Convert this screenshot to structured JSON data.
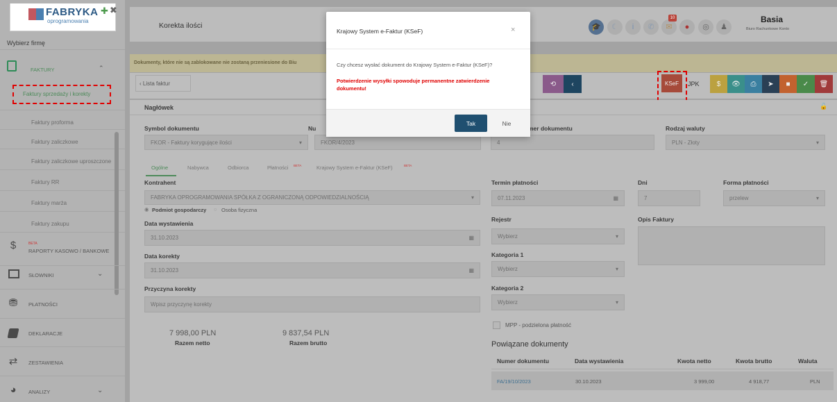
{
  "logo": {
    "brand": "FABRYKA",
    "sub": "oprogramowania"
  },
  "sidebar": {
    "company_placeholder": "Wybierz firmę",
    "section": "FAKTURY",
    "sub_items": [
      "Faktury sprzedaży i korekty",
      "Faktury proforma",
      "Faktury zaliczkowe",
      "Faktury zaliczkowe uproszczone",
      "Faktury RR",
      "Faktury marża",
      "Faktury zakupu"
    ],
    "beta": "BETA",
    "raporty": "RAPORTY KASOWO / BANKOWE",
    "slowniki": "SŁOWNIKI",
    "platnosci": "PŁATNOŚCI",
    "deklaracje": "DEKLARACJE",
    "zestawienia": "ZESTAWIENIA",
    "analizy": "ANALIZY"
  },
  "header": {
    "title": "Korekta ilości",
    "user": "Basia",
    "role": "Biuro Rachunkowe Konto",
    "badge": "10"
  },
  "banner": "Dokumenty, które nie są zablokowane nie zostaną przeniesione do Biu",
  "toolbar": {
    "back": "‹ Lista faktur",
    "ksef": "KSeF",
    "jpk": "JPK"
  },
  "headline": "Nagłówek",
  "form": {
    "symbol_label": "Symbol dokumentu",
    "symbol_value": "FKOR - Faktury korygujące ilości",
    "nu_label": "Nu",
    "nu_value": "FKOR/4/2023",
    "mer_label": "mer dokumentu",
    "mer_value": "4",
    "currency_label": "Rodzaj waluty",
    "currency_value": "PLN - Złoty",
    "tabs": [
      "Ogólne",
      "Nabywca",
      "Odbiorca",
      "Płatności",
      "Krajowy System e-Faktur (KSeF)"
    ],
    "beta": "BETA",
    "kontrahent_label": "Kontrahent",
    "kontrahent_value": "FABRYKA OPROGRAMOWANIA SPÓŁKA Z OGRANICZONĄ ODPOWIEDZIALNOŚCIĄ",
    "radio1": "Podmiot gospodarczy",
    "radio2": "Osoba fizyczna",
    "data_wyst_label": "Data wystawienia",
    "data_wyst_value": "31.10.2023",
    "data_kor_label": "Data korekty",
    "data_kor_value": "31.10.2023",
    "przyczyna_label": "Przyczyna korekty",
    "przyczyna_placeholder": "Wpisz przyczynę korekty",
    "netto_value": "7 998,00 PLN",
    "netto_label": "Razem netto",
    "brutto_value": "9 837,54 PLN",
    "brutto_label": "Razem brutto",
    "termin_label": "Termin płatności",
    "termin_value": "07.11.2023",
    "dni_label": "Dni",
    "dni_value": "7",
    "forma_label": "Forma płatności",
    "forma_value": "przelew",
    "rejestr_label": "Rejestr",
    "rejestr_value": "Wybierz",
    "opis_label": "Opis Faktury",
    "kat1_label": "Kategoria 1",
    "kat1_value": "Wybierz",
    "kat2_label": "Kategoria 2",
    "kat2_value": "Wybierz",
    "mpp_label": "MPP - podzielona płatność",
    "related_title": "Powiązane dokumenty",
    "related_headers": [
      "Numer dokumentu",
      "Data wystawienia",
      "Kwota netto",
      "Kwota brutto",
      "Waluta"
    ],
    "related_row": [
      "FA/19/10/2023",
      "30.10.2023",
      "3 999,00",
      "4 918,77",
      "PLN"
    ]
  },
  "dialog": {
    "title": "Krajowy System e-Faktur (KSeF)",
    "close": "×",
    "question": "Czy chcesz wysłać dokument do Krajowy System e-Faktur (KSeF)?",
    "warning": "Potwierdzenie wysyłki spowoduje permanentne zatwierdzenie dokumentu!",
    "yes": "Tak",
    "no": "Nie"
  },
  "colors": {
    "accent": "#1f4f70",
    "warning": "#e00000",
    "ksef": "#b53a2a"
  }
}
